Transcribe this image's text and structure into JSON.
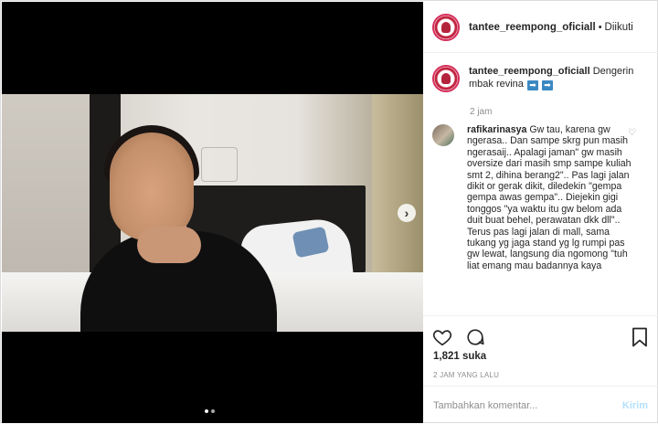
{
  "header": {
    "username": "tantee_reempong_oficiall",
    "separator": "•",
    "follow_status": "Diikuti"
  },
  "caption": {
    "username": "tantee_reempong_oficiall",
    "text": "Dengerin mbak revina",
    "emoji": [
      "➡",
      "➡"
    ],
    "time": "2 jam"
  },
  "comments": [
    {
      "username": "rafikarinasya",
      "text": "Gw tau, karena gw ngerasa.. Dan sampe skrg pun masih ngerasaij.. Apalagi jaman\" gw masih oversize dari masih smp sampe kuliah smt 2, dihina berang2\".. Pas lagi jalan dikit or gerak dikit, diledekin \"gempa gempa awas gempa\".. Diejekin gigi tonggos \"ya waktu itu gw belom ada duit buat behel, perawatan dkk dll\".. Terus pas lagi jalan di mall, sama tukang yg jaga stand yg lg rumpi pas gw lewat, langsung dia ngomong \"tuh liat emang mau badannya kaya"
    }
  ],
  "actions": {
    "likes": "1,821 suka",
    "time_ago": "2 JAM YANG LALU"
  },
  "composer": {
    "placeholder": "Tambahkan komentar...",
    "post_label": "Kirim"
  },
  "carousel": {
    "total": 2,
    "active_index": 0
  },
  "colors": {
    "accent_blue": "#3b88c3",
    "post_disabled": "#b2dffc",
    "muted": "#8e8e8e"
  }
}
